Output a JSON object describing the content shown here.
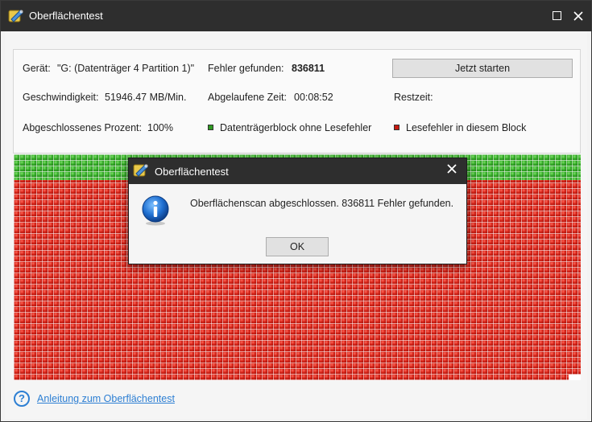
{
  "window": {
    "title": "Oberflächentest",
    "maximize_icon": "maximize-icon",
    "close_icon": "close-icon"
  },
  "info": {
    "device_label": "Gerät:",
    "device_value": "\"G: (Datenträger 4 Partition 1)\"",
    "errors_label": "Fehler gefunden:",
    "errors_value": "836811",
    "start_button": "Jetzt starten",
    "speed_label": "Geschwindigkeit:",
    "speed_value": "51946.47 MB/Min.",
    "elapsed_label": "Abgelaufene Zeit:",
    "elapsed_value": "00:08:52",
    "remaining_label": "Restzeit:",
    "remaining_value": "",
    "percent_label": "Abgeschlossenes Prozent:",
    "percent_value": "100%",
    "legend_ok": "Datenträgerblock ohne Lesefehler",
    "legend_error": "Lesefehler in diesem Block"
  },
  "colors": {
    "ok_block": "#2f9a22",
    "error_block": "#c81a10",
    "titlebar": "#2e2e2e",
    "link": "#2d7fd3"
  },
  "help": {
    "icon": "question-icon",
    "link_text": "Anleitung zum Oberflächentest"
  },
  "dialog": {
    "title": "Oberflächentest",
    "message": "Oberflächenscan abgeschlossen. 836811 Fehler gefunden.",
    "ok_label": "OK",
    "icon": "info-icon"
  }
}
